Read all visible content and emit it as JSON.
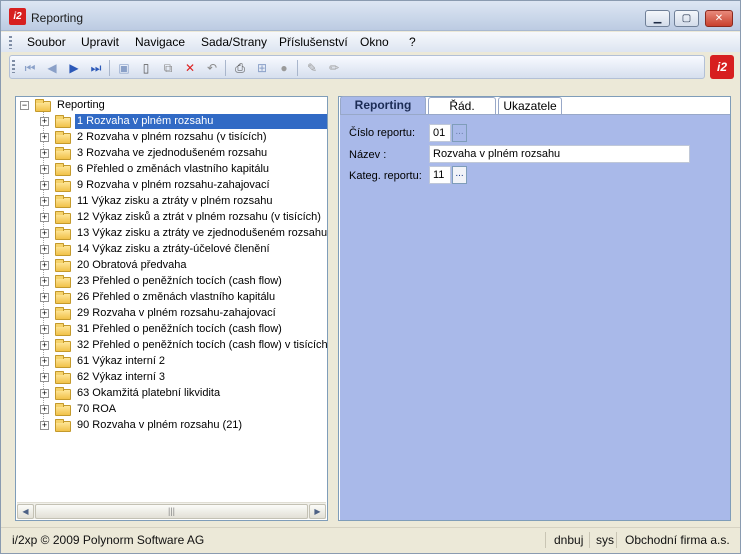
{
  "window": {
    "title": "Reporting",
    "app_icon": "i2",
    "minimize_icon": "minimize-icon",
    "maximize_icon": "maximize-icon",
    "close_icon": "close-icon"
  },
  "menu": {
    "items": [
      "Soubor",
      "Upravit",
      "Navigace",
      "Sada/Strany",
      "Příslušenství",
      "Okno",
      "?"
    ]
  },
  "toolbar": {
    "buttons": [
      "first-record-icon",
      "prev-record-icon",
      "next-record-icon",
      "last-record-icon",
      "save-icon",
      "new-icon",
      "copy-icon",
      "delete-icon",
      "undo-icon",
      "print-icon",
      "structure-icon",
      "disabled-icon",
      "edit-icon",
      "edit-alt-icon"
    ]
  },
  "tree": {
    "root": "Reporting",
    "items": [
      "1 Rozvaha v plném rozsahu",
      "2 Rozvaha v plném rozsahu (v tisících)",
      "3 Rozvaha ve zjednodušeném rozsahu",
      "6 Přehled o změnách vlastního kapitálu",
      "9 Rozvaha v plném rozsahu-zahajovací",
      "11 Výkaz zisku a ztráty v plném rozsahu",
      "12 Výkaz zisků a ztrát v plném rozsahu (v tisících)",
      "13 Výkaz zisku a ztráty ve zjednodušeném rozsahu",
      "14 Výkaz zisku a ztráty-účelové členění",
      "20 Obratová předvaha",
      "23 Přehled o peněžních tocích (cash flow)",
      "26 Přehled o změnách vlastního kapitálu",
      "29 Rozvaha v plném rozsahu-zahajovací",
      "31 Přehled o peněžních tocích (cash flow)",
      "32 Přehled o peněžních tocích (cash flow) v tisících",
      "61 Výkaz interní 2",
      "62 Výkaz interní 3",
      "63 Okamžitá platební likvidita",
      "70 ROA",
      "90 Rozvaha v plném rozsahu (21)"
    ],
    "selected_index": 0
  },
  "tabs": [
    "Reporting",
    "Řád. reportu",
    "Ukazatele"
  ],
  "form": {
    "cislo_label": "Číslo reportu:",
    "cislo_value": "01",
    "nazev_label": "Název      :",
    "nazev_value": "Rozvaha v plném rozsahu",
    "kateg_label": "Kateg. reportu:",
    "kateg_value": "11",
    "ellipsis": "..."
  },
  "status": {
    "copyright": "i/2xp © 2009 Polynorm Software AG",
    "user": "dnbuj",
    "db": "sys",
    "company": "Obchodní firma a.s."
  },
  "colors": {
    "tab_body": "#a9b9e9",
    "selection": "#316ac5",
    "brand_red": "#d71f1f"
  }
}
